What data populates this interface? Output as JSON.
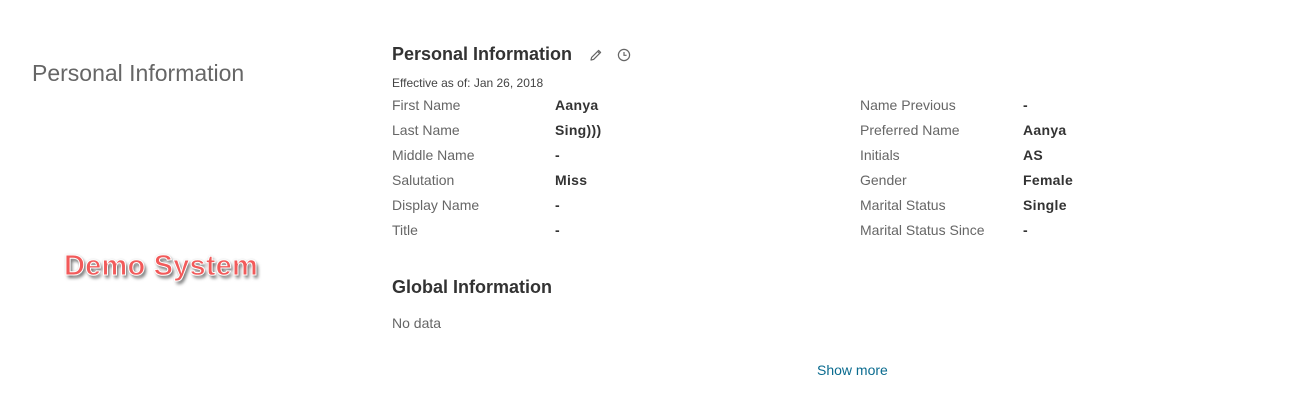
{
  "page_title": "Personal Information",
  "watermark": "Demo System",
  "section": {
    "title": "Personal Information",
    "edit_icon": "pencil-icon",
    "history_icon": "clock-icon",
    "effective_text": "Effective as of: Jan 26, 2018"
  },
  "left_fields": [
    {
      "label": "First Name",
      "value": "Aanya"
    },
    {
      "label": "Last Name",
      "value": "Sing)))"
    },
    {
      "label": "Middle Name",
      "value": "-"
    },
    {
      "label": "Salutation",
      "value": "Miss"
    },
    {
      "label": "Display Name",
      "value": "-"
    },
    {
      "label": "Title",
      "value": "-"
    }
  ],
  "right_fields": [
    {
      "label": "Name Previous",
      "value": "-"
    },
    {
      "label": "Preferred Name",
      "value": "Aanya"
    },
    {
      "label": "Initials",
      "value": "AS"
    },
    {
      "label": "Gender",
      "value": "Female"
    },
    {
      "label": "Marital Status",
      "value": "Single"
    },
    {
      "label": "Marital Status Since",
      "value": "-"
    }
  ],
  "global": {
    "title": "Global Information",
    "empty_text": "No data"
  },
  "show_more_label": "Show more",
  "colors": {
    "link": "#0a6b8f",
    "watermark": "#f25a5a",
    "label": "#666666",
    "value": "#333333"
  }
}
